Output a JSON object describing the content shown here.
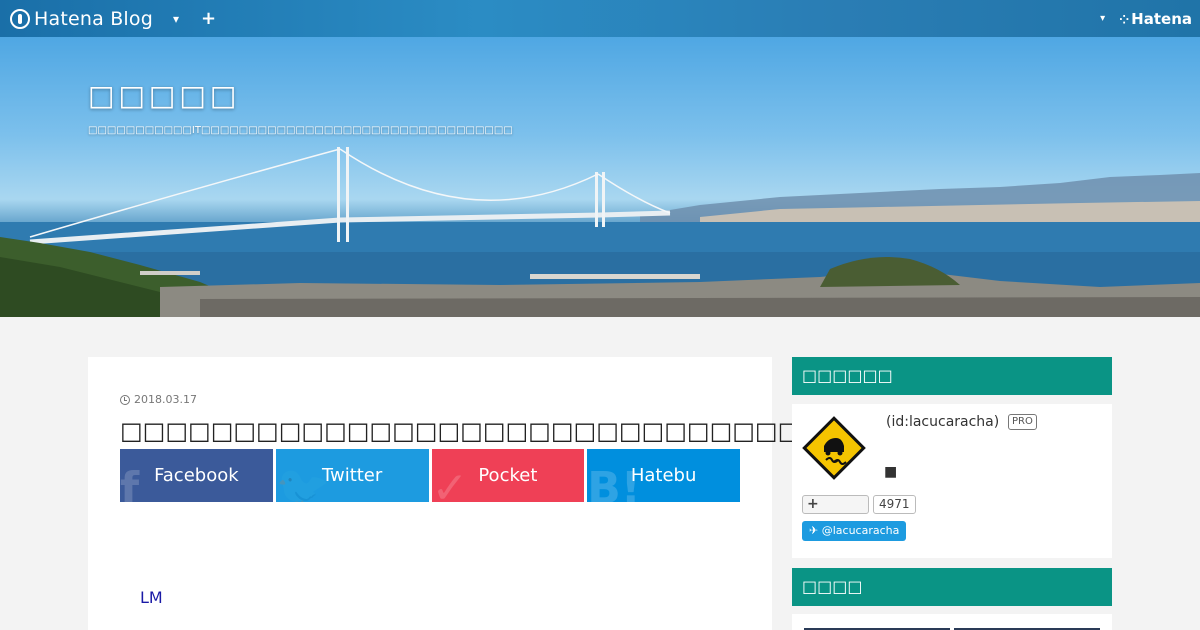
{
  "globalheader": {
    "logo_text": "Hatena Blog",
    "dropdown_caret": "▾",
    "plus_label": "+",
    "right_caret": "▾",
    "hatena_label": "Hatena"
  },
  "blog": {
    "title": "□□□□□",
    "description": "□□□□□□□□□□□IT□□□□□□□□□□□□□□□□□□□□□□□□□□□□□□□□□"
  },
  "entry": {
    "date": "2018.03.17",
    "title": "□□□□□□□□□□□□□□□□□□□□□□□□□□□□□□□□□□□□□",
    "link_text": "LM"
  },
  "share": [
    {
      "label": "Facebook",
      "ghost": "f",
      "color": "#3b5a9a"
    },
    {
      "label": "Twitter",
      "ghost": "🐦",
      "color": "#1d9be0"
    },
    {
      "label": "Pocket",
      "ghost": "✓",
      "color": "#ef4056"
    },
    {
      "label": "Hatebu",
      "ghost": "B!",
      "color": "#008fde"
    }
  ],
  "sidebar": {
    "profile_title": "□□□□□□",
    "profile_id": "(id:lacucaracha)",
    "pro_badge": "PRO",
    "profile_square": "■",
    "follow_label": "+",
    "follow_count": "4971",
    "twitter_handle": "@lacucaracha",
    "module2_title": "□□□□"
  },
  "colors": {
    "accent": "#0a9485",
    "link": "#1a1aa6"
  }
}
